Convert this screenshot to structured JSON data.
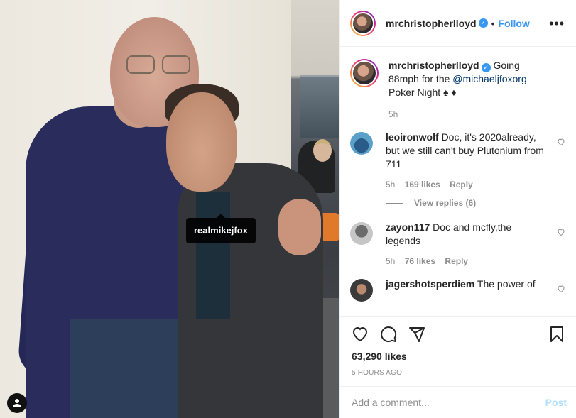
{
  "photo": {
    "tag_label": "realmikejfox",
    "user_tag_icon": "user-icon"
  },
  "header": {
    "username": "mrchristopherlloyd",
    "verified": "✓",
    "separator": "•",
    "follow": "Follow",
    "more": "•••"
  },
  "caption": {
    "username": "mrchristopherlloyd",
    "verified": "✓",
    "text_before": "Going 88mph for the ",
    "mention": "@michaeljfoxorg",
    "text_after": " Poker Night ♠ ♦",
    "time": "5h"
  },
  "comments": [
    {
      "username": "leoironwolf",
      "text": "Doc, it's 2020already, but we still can't buy Plutonium from 711",
      "time": "5h",
      "likes": "169 likes",
      "reply": "Reply",
      "view_replies": "View replies (6)"
    },
    {
      "username": "zayon117",
      "text": "Doc and mcfly,the legends",
      "time": "5h",
      "likes": "76 likes",
      "reply": "Reply"
    },
    {
      "username": "jagershotsperdiem",
      "text": "The power of"
    }
  ],
  "actions": {
    "likes": "63,290 likes",
    "timestamp": "5 HOURS AGO",
    "icons": [
      "heart-icon",
      "comment-icon",
      "share-icon",
      "bookmark-icon"
    ]
  },
  "add_comment": {
    "placeholder": "Add a comment...",
    "post": "Post"
  },
  "colors": {
    "accent": "#3897f0",
    "post_disabled": "#b2dffc",
    "muted": "#8e8e8e",
    "text": "#262626"
  }
}
